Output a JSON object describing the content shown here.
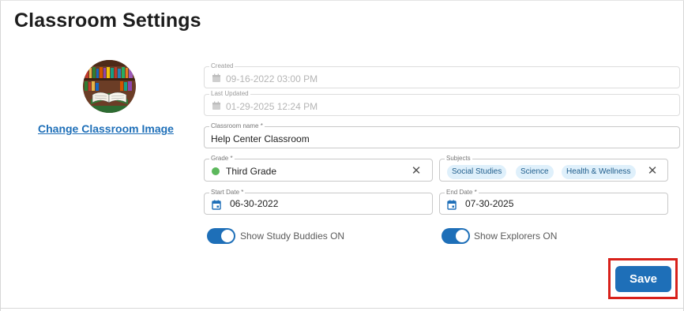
{
  "page": {
    "title": "Classroom Settings"
  },
  "image": {
    "change_label": "Change Classroom Image"
  },
  "form": {
    "created": {
      "label": "Created",
      "value": "09-16-2022 03:00 PM"
    },
    "last_updated": {
      "label": "Last Updated",
      "value": "01-29-2025 12:24 PM"
    },
    "classroom_name": {
      "label": "Classroom name *",
      "value": "Help Center Classroom"
    },
    "grade": {
      "label": "Grade *",
      "value": "Third Grade",
      "status_color": "#5cb85c"
    },
    "subjects": {
      "label": "Subjects",
      "chips": [
        "Social Studies",
        "Science",
        "Health & Wellness"
      ]
    },
    "start_date": {
      "label": "Start Date *",
      "value": "06-30-2022"
    },
    "end_date": {
      "label": "End Date *",
      "value": "07-30-2025"
    },
    "study_buddies": {
      "label": "Show Study Buddies ON",
      "on": true
    },
    "explorers": {
      "label": "Show Explorers ON",
      "on": true
    }
  },
  "actions": {
    "save_label": "Save"
  },
  "colors": {
    "accent": "#1e6fb8",
    "highlight_border": "#d8211b",
    "chip_bg": "#dff0fb"
  },
  "icons": {
    "field_calendar": "calendar-icon",
    "clear": "close-icon"
  }
}
